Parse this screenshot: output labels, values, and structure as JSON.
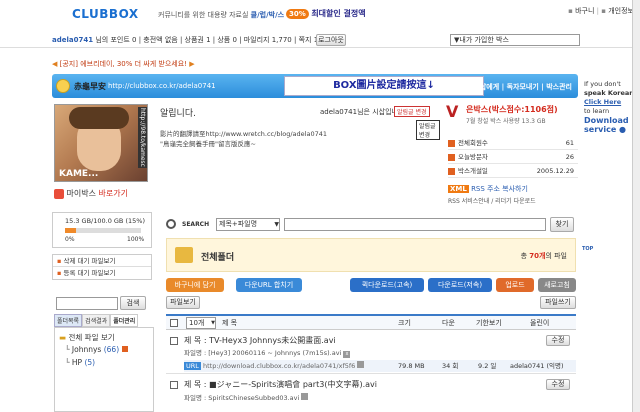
{
  "header": {
    "logo": "CLUBBOX",
    "tagline": "커뮤니티를 위한 대용량 자료실",
    "tagline_hl": "클/럽/박/스",
    "promo_pct": "30%",
    "promo_text": "최대할인 결정액",
    "top_links": [
      "바구니",
      "개인정보"
    ]
  },
  "userbar": {
    "user": "adela0741",
    "user_suffix": "님의",
    "points": "포인트 0",
    "charge": "| 충전액 없음",
    "coupon": "| 상품권 1",
    "coupon2": "| 상품 0",
    "mileage": "| 마일리지 1,770",
    "slots": "| 쪽지 18",
    "logout": "로그아웃",
    "box_select": "▼내가 가입한 박스"
  },
  "notice": {
    "text": "[공지] 에브리데이, 30% 더 싸게 받으세요!"
  },
  "box_header": {
    "chinese_title": "赤龜早安",
    "url": "http://clubbox.co.kr/adela0741",
    "banner_text": "BOX圖片設定請按這↓",
    "right_link": "시삽에게 | 독자모내기 | 박스관리"
  },
  "profile": {
    "vertical_url": "http://98.to/kamesc",
    "caption": "KAME...",
    "mybox_btn": "마이박스",
    "mybox_link": "바로가기"
  },
  "greeting": {
    "title": "알립니다.",
    "user_line": "adela0741님은 시삽입니다.",
    "change_btn": "알림글 변경",
    "tooltip": "알림글변경",
    "text_line1": "影片的翻譯請至http://www.wretch.cc/blog/adela0741",
    "text_line2": "\"鳥龜完全飼養手冊\"留言版反應~"
  },
  "box_stats": {
    "title_prefix": "은박스",
    "title_detail": "(박스점수:1106점)",
    "date": "7월 창설 박스 사용량 13.3 GB",
    "rows": [
      {
        "label": "전체회원수",
        "value": "61"
      },
      {
        "label": "오늘방문자",
        "value": "26"
      },
      {
        "label": "박스개설일",
        "value": "2005.12.29"
      }
    ],
    "rss_badge": "XML",
    "rss_text": "RSS 주소 복사하기",
    "rss_sub": "RSS 서비스안내 / 리더기 다운로드"
  },
  "quota": {
    "used": "15.3 GB/100.0 GB (15%)",
    "zero": "0%",
    "hundred": "100%",
    "used_fraction": 0.15
  },
  "queues": [
    "삭제 대기 파일보기",
    "등록 대기 파일보기"
  ],
  "sidebar_search": {
    "btn": "검색"
  },
  "folder_tabs": [
    "폴더목록",
    "검색결과",
    "폴더관리"
  ],
  "folders": {
    "root": "전체 파일 보기",
    "items": [
      {
        "name": "Johnnys",
        "count": "(66)"
      },
      {
        "name": "HP",
        "count": "(5)"
      }
    ]
  },
  "search": {
    "label": "SEARCH",
    "select": "제목+파일명",
    "btn": "찾기"
  },
  "all_folder": {
    "title": "전체폴더",
    "total_prefix": "총",
    "total_count": "70개",
    "total_suffix": "의 파일"
  },
  "toolbar": {
    "basket": "바구니에 담기",
    "url_copy": "다운URL 합치기",
    "quick_down": "퀵다운로드",
    "quick_down_sub": "(고속)",
    "down": "다운로드",
    "down_sub": "(저속)",
    "upload": "업로드",
    "refresh": "새로고침"
  },
  "sub": {
    "file_view": "파일보기",
    "file_write": "파일쓰기"
  },
  "table": {
    "count_select": "10개",
    "headers": [
      "제 목",
      "크기",
      "다운",
      "기한보기",
      "올린이"
    ]
  },
  "files": [
    {
      "title": "TV-Heyx3 Johnnys未公開畫面.avi",
      "filename": "[Hey3] 20060116 ~ Johnnys (7m15s).avi",
      "url": "http://download.clubbox.co.kr/adela0741/xf5f6",
      "size": "79.8 MB",
      "down": "34 회",
      "deadline": "9.2 일",
      "uploader": "adela0741 (익명)",
      "edit": "수정"
    },
    {
      "title": "제 목 : ■ジャニー-Spirits演唱會 part3(中文字幕).avi",
      "filename": "SpiritsChineseSubbed03.avi",
      "edit": "수정"
    }
  ],
  "side_ad": {
    "line1": "If you don't",
    "line2": "speak Korean,",
    "line3": "Click Here",
    "line4": "to learn",
    "line5": "Download",
    "line6": "service ●"
  },
  "top_btn": "TOP"
}
